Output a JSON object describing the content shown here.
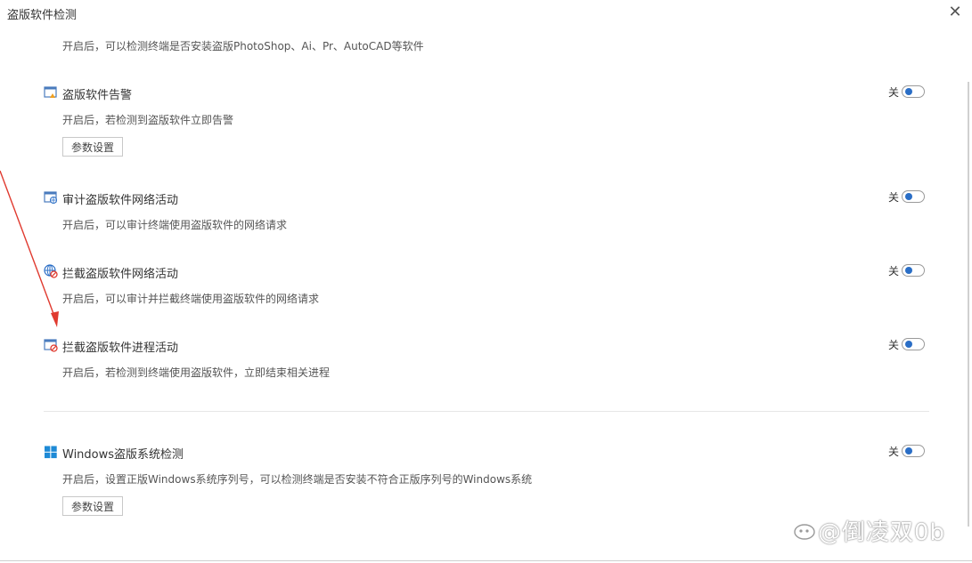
{
  "window": {
    "title": "盗版软件检测",
    "close_icon": "close-icon"
  },
  "top_desc": "开启后，可以检测终端是否安装盗版PhotoShop、Ai、Pr、AutoCAD等软件",
  "settings": [
    {
      "title": "盗版软件告警",
      "desc": "开启后，若检测到盗版软件立即告警",
      "icon": "warning-window-icon",
      "switch_label": "关",
      "button_label": "参数设置"
    },
    {
      "title": "审计盗版软件网络活动",
      "desc": "开启后，可以审计终端使用盗版软件的网络请求",
      "icon": "network-audit-icon",
      "switch_label": "关"
    },
    {
      "title": "拦截盗版软件网络活动",
      "desc": "开启后，可以审计并拦截终端使用盗版软件的网络请求",
      "icon": "network-block-icon",
      "switch_label": "关"
    },
    {
      "title": "拦截盗版软件进程活动",
      "desc": "开启后，若检测到终端使用盗版软件，立即结束相关进程",
      "icon": "process-block-icon",
      "switch_label": "关"
    },
    {
      "title": "Windows盗版系统检测",
      "desc": "开启后，设置正版Windows系统序列号，可以检测终端是否安装不符合正版序列号的Windows系统",
      "icon": "windows-logo-icon",
      "switch_label": "关",
      "button_label": "参数设置"
    }
  ],
  "watermark": "@倒凌双0b",
  "colors": {
    "accent": "#2a6ec6",
    "annotation_arrow": "#e03a2f"
  }
}
